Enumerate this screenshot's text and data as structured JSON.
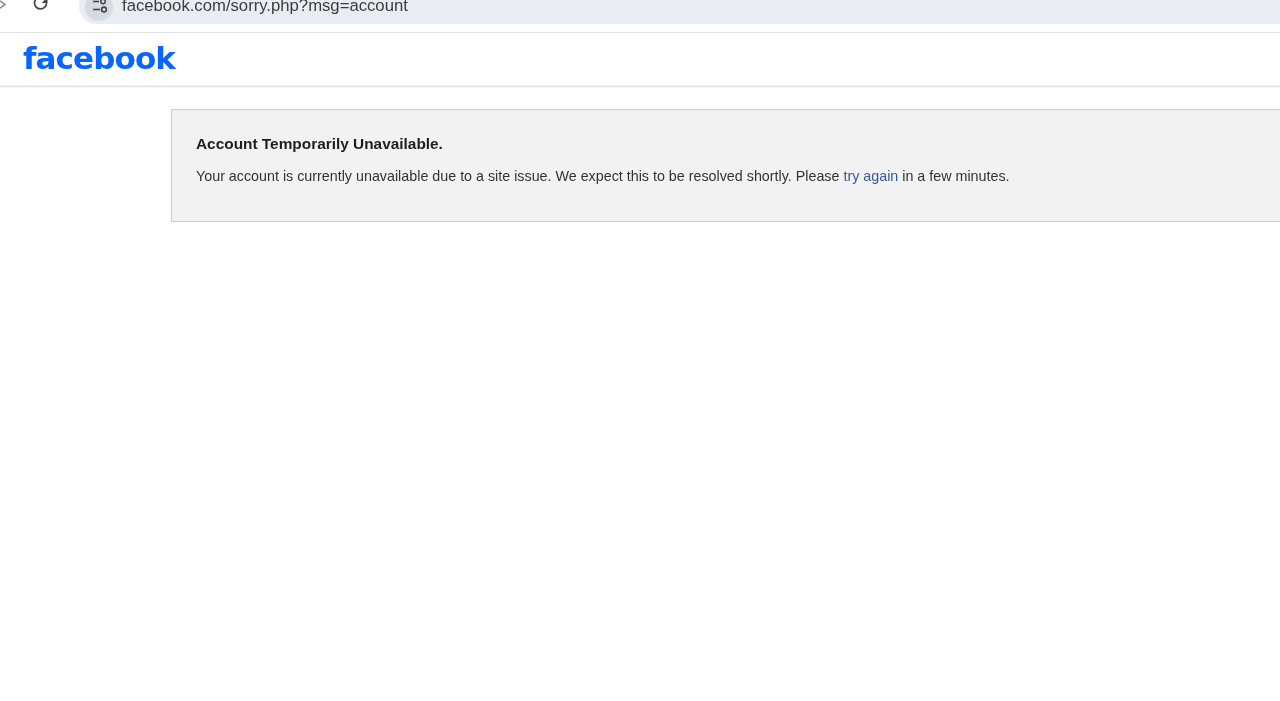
{
  "browser": {
    "url": "facebook.com/sorry.php?msg=account"
  },
  "header": {
    "logo": "facebook"
  },
  "notice": {
    "title": "Account Temporarily Unavailable.",
    "message": [
      {
        "kind": "text",
        "text": "Your account is currently unavailable due to a site issue. We expect this to be resolved shortly. Please "
      },
      {
        "kind": "link",
        "text": "try again"
      },
      {
        "kind": "text",
        "text": " in a few minutes."
      }
    ]
  }
}
